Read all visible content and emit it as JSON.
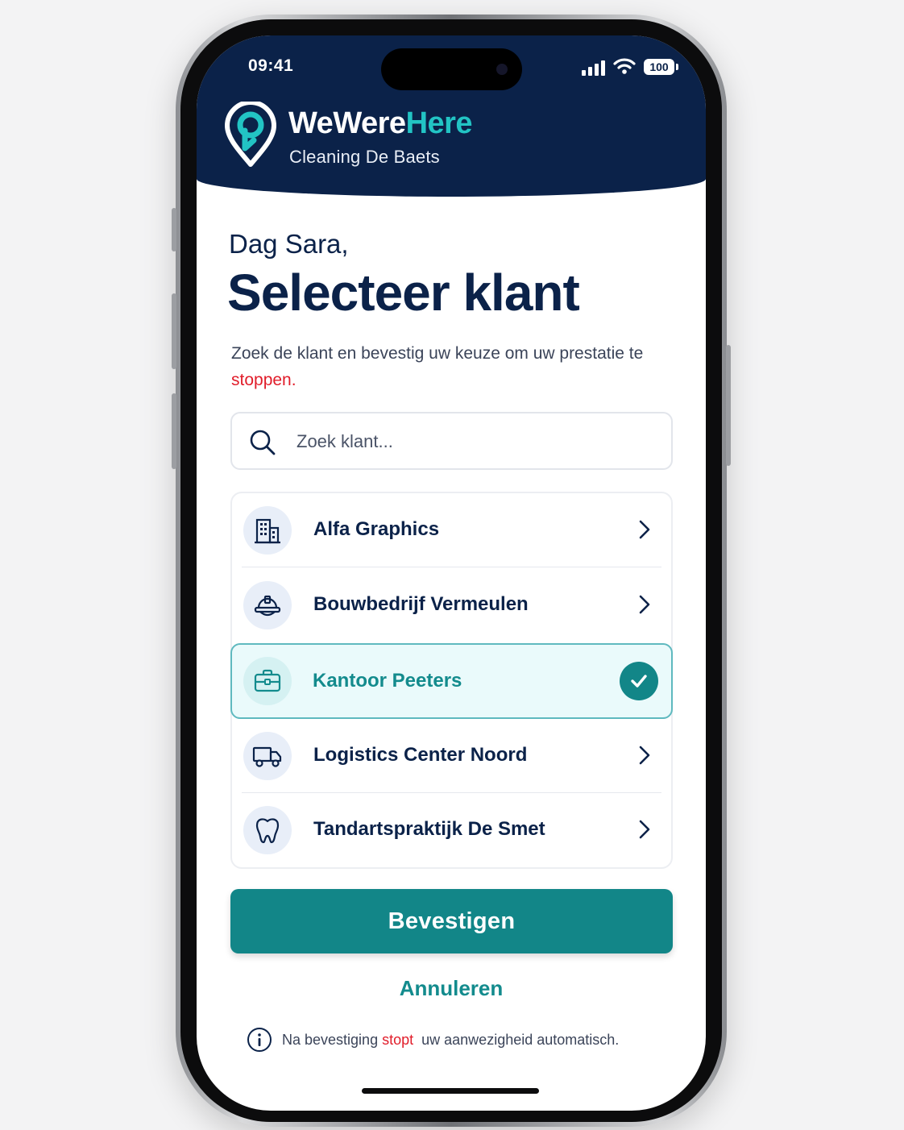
{
  "status_bar": {
    "time": "09:41",
    "battery": "100"
  },
  "header": {
    "brand_prefix": "WeWere",
    "brand_accent": "Here",
    "subtitle": "Cleaning De Baets"
  },
  "main": {
    "greeting": "Dag Sara,",
    "title": "Selecteer klant",
    "description_prefix": "Zoek de klant en bevestig uw keuze om uw prestatie te ",
    "description_emphasis": "stoppen.",
    "search": {
      "placeholder": "Zoek klant..."
    },
    "clients": [
      {
        "label": "Alfa Graphics",
        "icon": "building-icon",
        "selected": false
      },
      {
        "label": "Bouwbedrijf Vermeulen",
        "icon": "hard-hat-icon",
        "selected": false
      },
      {
        "label": "Kantoor Peeters",
        "icon": "briefcase-icon",
        "selected": true
      },
      {
        "label": "Logistics Center Noord",
        "icon": "truck-icon",
        "selected": false
      },
      {
        "label": "Tandartspraktijk De Smet",
        "icon": "tooth-icon",
        "selected": false
      }
    ],
    "confirm_label": "Bevestigen",
    "cancel_label": "Annuleren",
    "note_prefix": "Na bevestiging",
    "note_emphasis": "stopt",
    "note_suffix": "uw aanwezigheid automatisch."
  },
  "colors": {
    "header_bg": "#0b2249",
    "accent_teal": "#128688",
    "brand_accent": "#22c4c4",
    "warning_red": "#e11d2a"
  }
}
